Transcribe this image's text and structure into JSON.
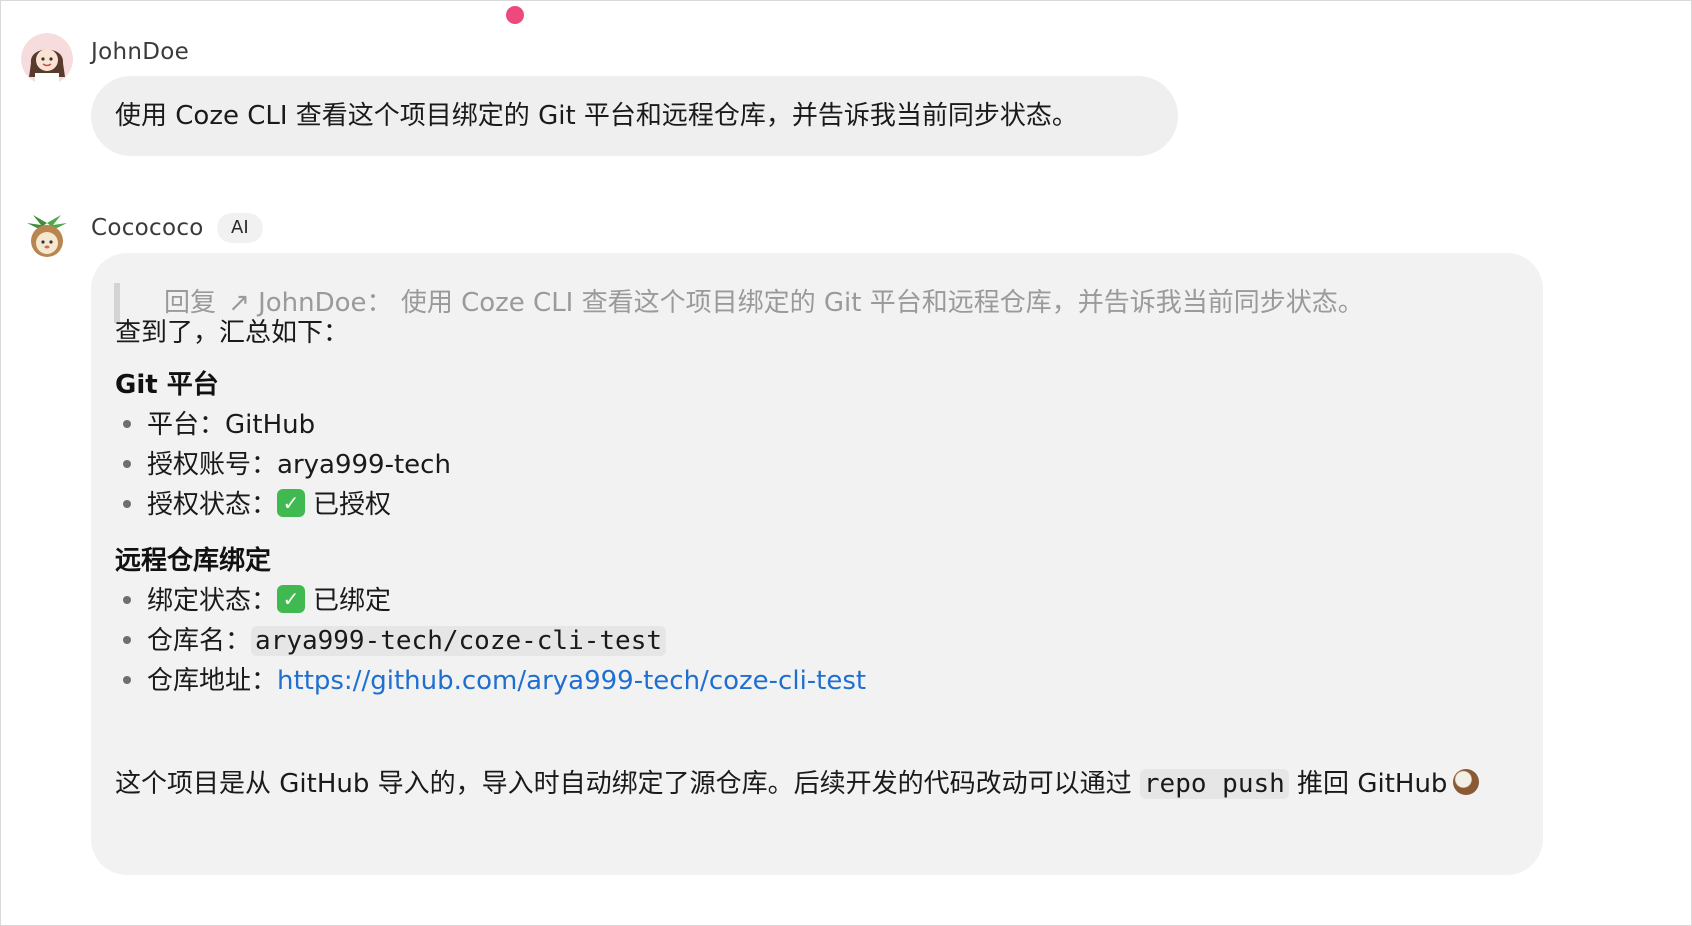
{
  "conversation": {
    "user": {
      "name": "JohnDoe",
      "message": "使用 Coze CLI 查看这个项目绑定的 Git 平台和远程仓库，并告诉我当前同步状态。"
    },
    "assistant": {
      "name": "Cocococo",
      "badge": "AI",
      "quote": {
        "prefix": "回复",
        "reply_icon": "↗",
        "author": "JohnDoe：",
        "text": "使用 Coze CLI 查看这个项目绑定的 Git 平台和远程仓库，并告诉我当前同步状态。"
      },
      "intro": "查到了，汇总如下：",
      "git_section": {
        "heading": "Git 平台",
        "items": [
          {
            "label": "平台：",
            "value": "GitHub"
          },
          {
            "label": "授权账号：",
            "value": "arya999-tech"
          },
          {
            "label": "授权状态：",
            "check": "✓",
            "value": "已授权"
          }
        ]
      },
      "repo_section": {
        "heading": "远程仓库绑定",
        "items": [
          {
            "label": "绑定状态：",
            "check": "✓",
            "value": "已绑定"
          },
          {
            "label": "仓库名：",
            "value": "arya999-tech/coze-cli-test"
          },
          {
            "label": "仓库地址：",
            "value": "https://github.com/arya999-tech/coze-cli-test"
          }
        ]
      },
      "closing": {
        "part1": "这个项目是从 GitHub 导入的，导入时自动绑定了源仓库。后续开发的代码改动可以通过 ",
        "code": "repo push",
        "part2": " 推回 GitHub"
      }
    }
  },
  "colors": {
    "accent_dot": "#ec4a7d",
    "link": "#1f6fd1",
    "check_green": "#3fb950"
  }
}
